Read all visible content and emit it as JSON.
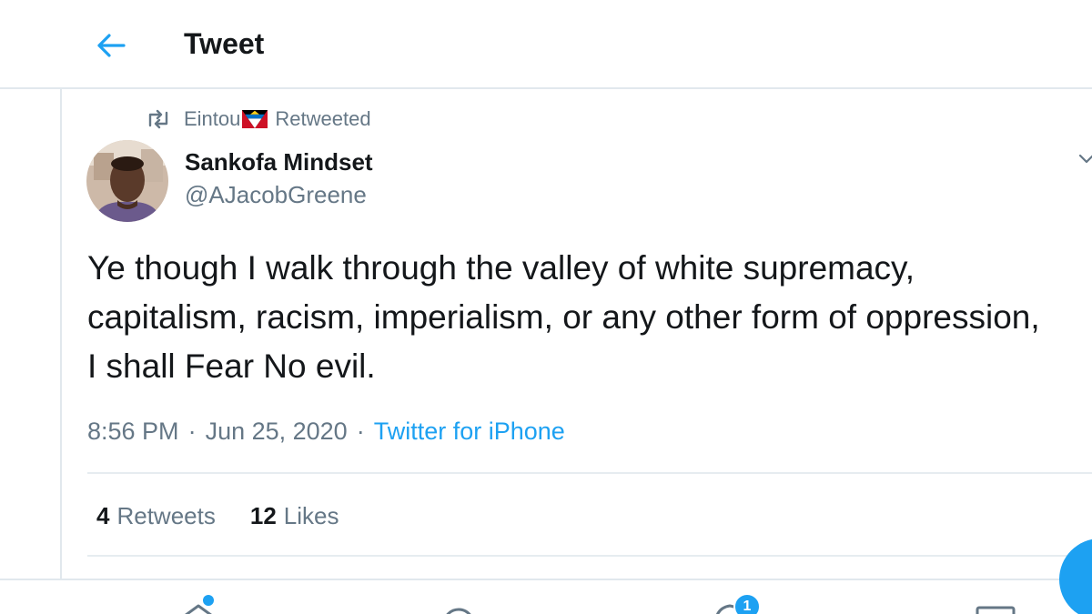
{
  "header": {
    "title": "Tweet",
    "back_icon": "arrow-left-icon"
  },
  "retweet_context": {
    "icon": "retweet-icon",
    "user": "Eintou",
    "flag_icon": "antigua-barbuda-flag",
    "label": "Retweeted"
  },
  "tweet": {
    "author_name": "Sankofa Mindset",
    "author_handle": "@AJacobGreene",
    "text": "Ye though I walk through the valley of white supremacy, capitalism, racism, imperialism, or any other form of oppression, I shall Fear No evil.",
    "time": "8:56 PM",
    "separator": "·",
    "date": "Jun 25, 2020",
    "source": "Twitter for iPhone"
  },
  "stats": {
    "retweets_count": "4",
    "retweets_label": "Retweets",
    "likes_count": "12",
    "likes_label": "Likes"
  },
  "bottom_nav": {
    "notifications_badge": "1"
  },
  "colors": {
    "accent": "#1da1f2",
    "text_primary": "#14171a",
    "text_secondary": "#657786",
    "divider": "#e1e8ed"
  }
}
